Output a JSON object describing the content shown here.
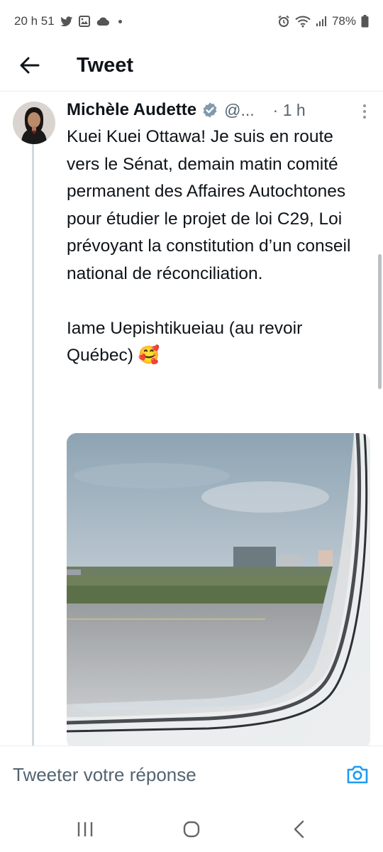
{
  "status_bar": {
    "time": "20 h 51",
    "battery": "78%",
    "left_icons": [
      "twitter-icon",
      "gallery-icon",
      "cloud-icon",
      "dot-icon"
    ],
    "right_icons": [
      "alarm-icon",
      "wifi-icon",
      "signal-icon",
      "battery-icon"
    ]
  },
  "header": {
    "title": "Tweet",
    "back_icon": "arrow-left-icon"
  },
  "tweet": {
    "author_name": "Michèle Audette",
    "handle": "@...",
    "time": "· 1 h",
    "text": "Kuei Kuei Ottawa! Je suis en route vers le Sénat, demain matin comité permanent des Affaires Autochtones pour étudier le projet de loi C29, Loi prévoyant la constitution d’un conseil national de réconciliation.\n\nIame Uepishtikueiau (au revoir Québec) 🥰",
    "verified_icon": "verified-badge-icon",
    "more_icon": "more-vertical-icon"
  },
  "reply_bar": {
    "placeholder": "Tweeter votre réponse",
    "camera_icon": "camera-icon"
  },
  "nav_bar": {
    "recent_icon": "recent-apps-icon",
    "home_icon": "home-icon",
    "back_icon": "back-chevron-icon"
  },
  "colors": {
    "accent": "#1d9bf0",
    "text": "#0f1419",
    "secondary_text": "#536471",
    "divider": "#e8ecef"
  }
}
